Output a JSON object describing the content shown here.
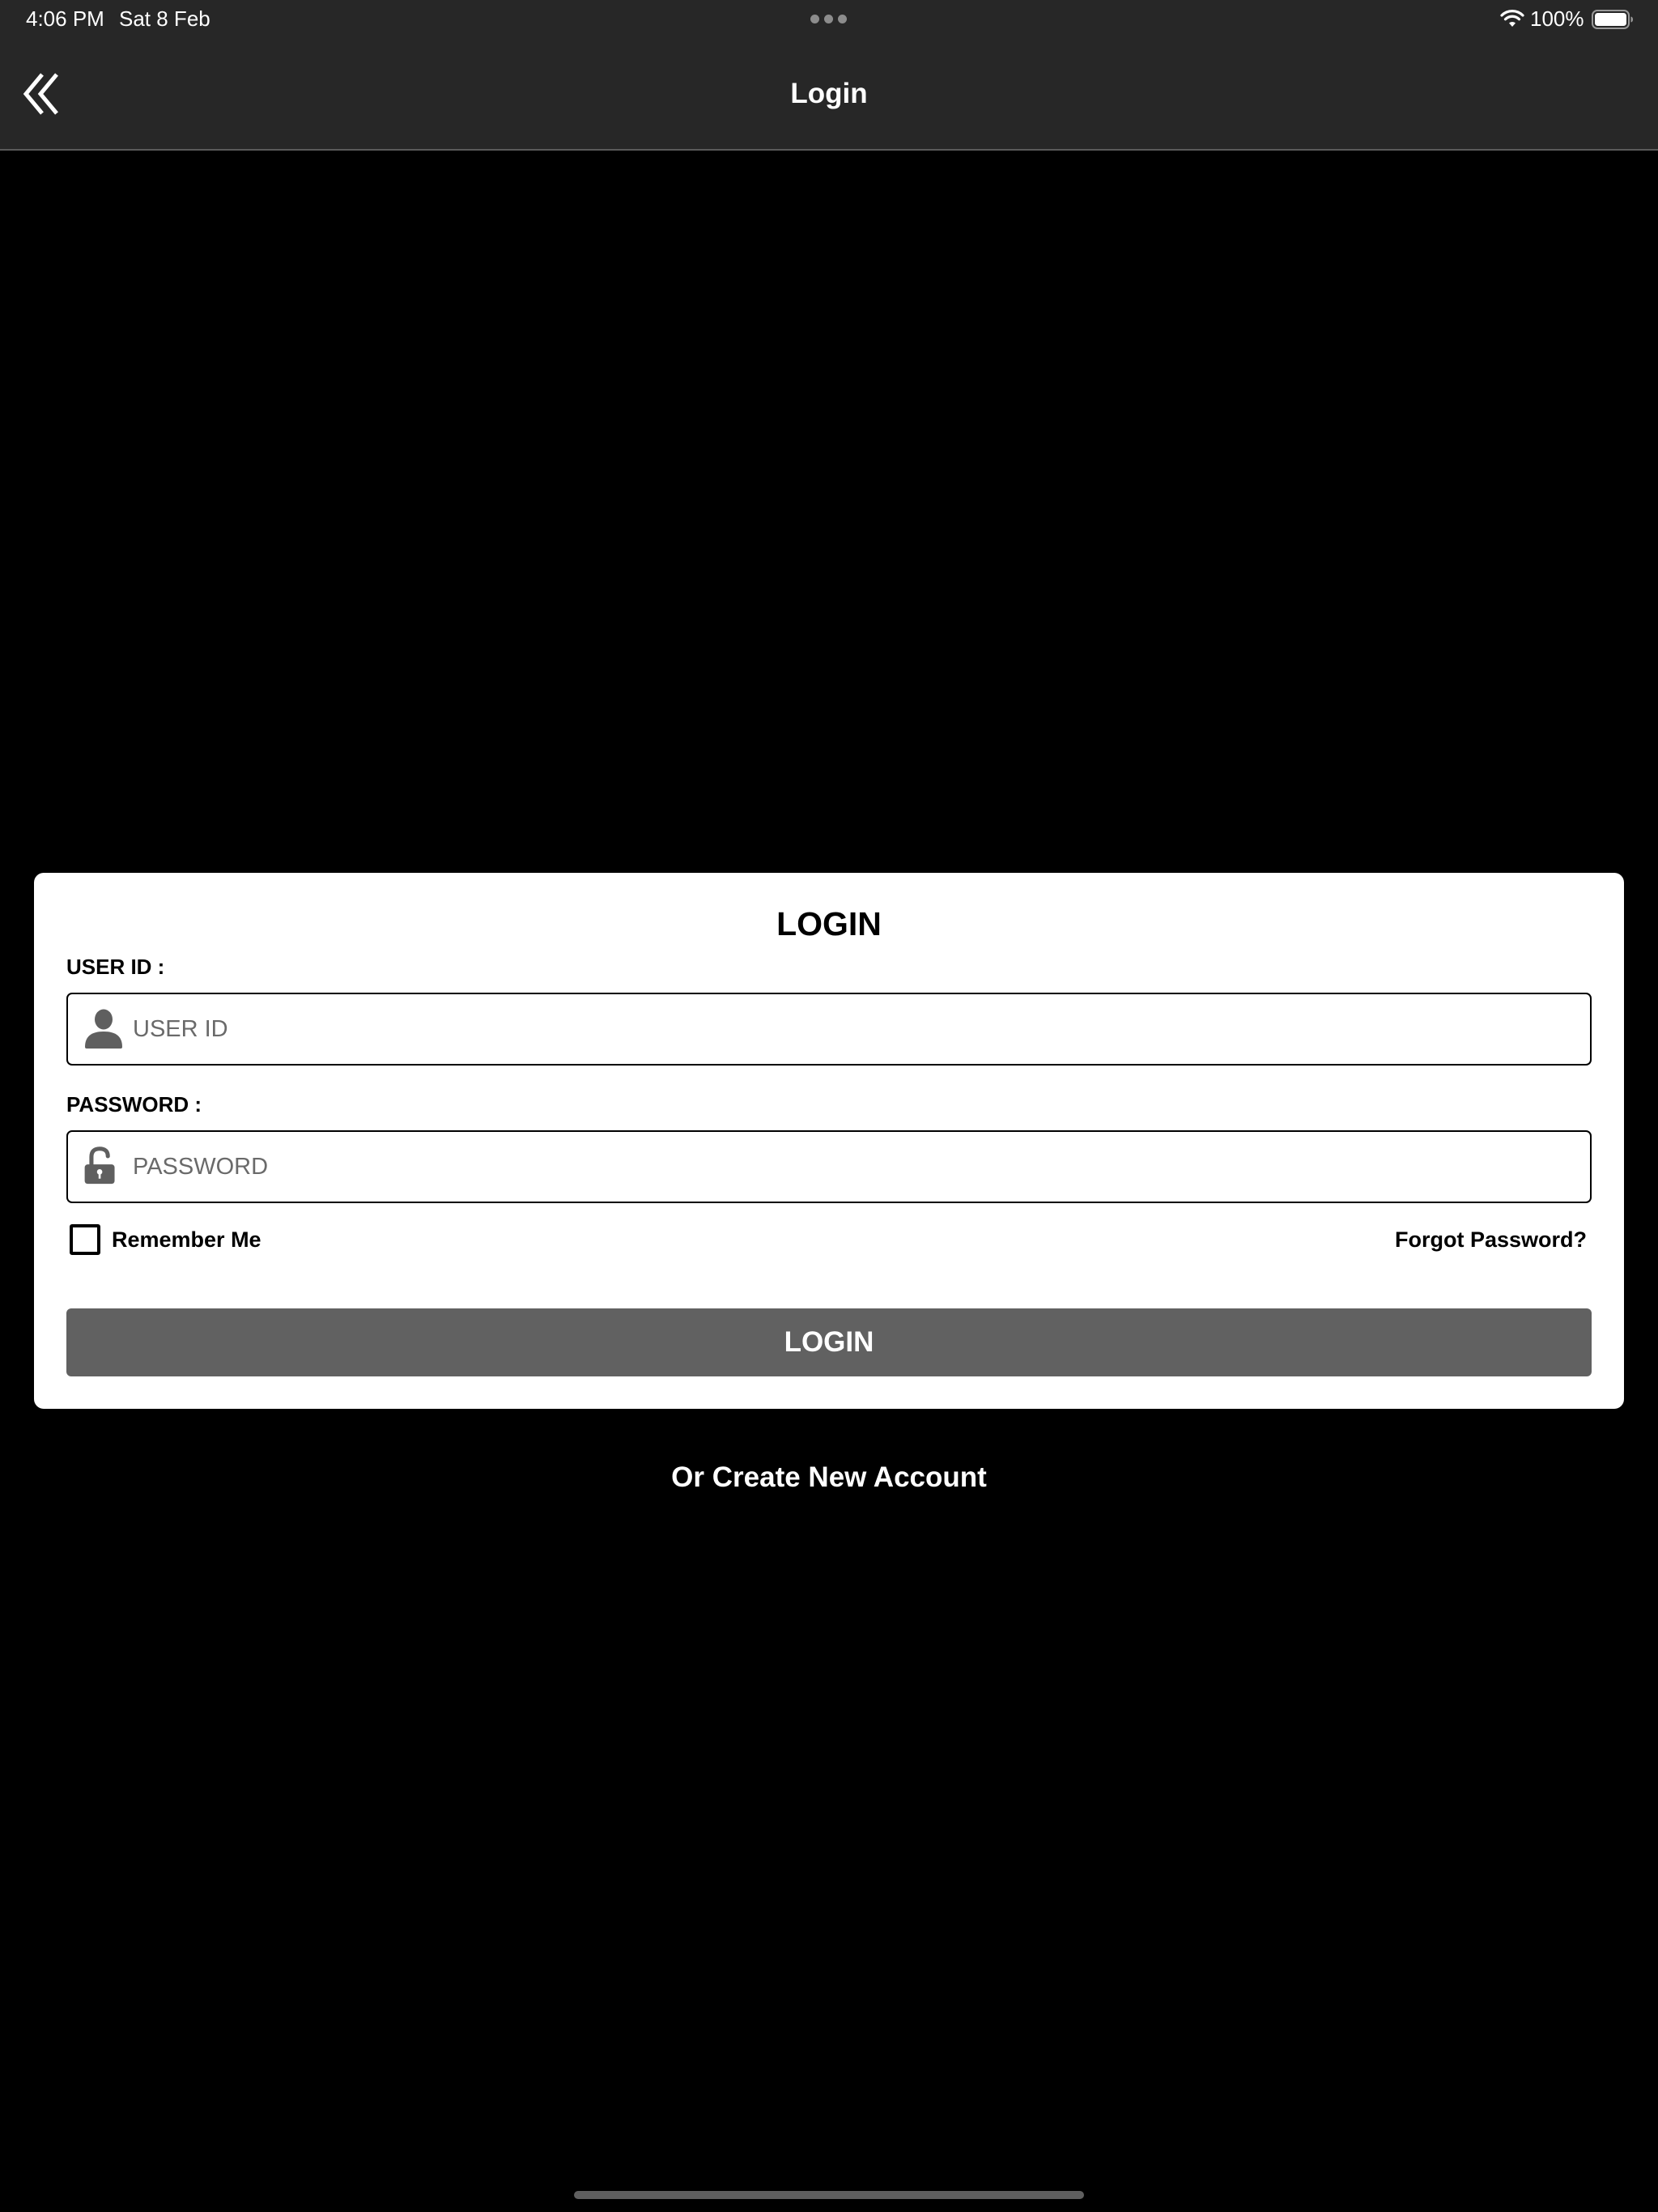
{
  "status_bar": {
    "time": "4:06 PM",
    "date": "Sat 8 Feb",
    "battery_percent": "100%",
    "battery_level": 1.0,
    "icons": [
      "multitasking-dots",
      "wifi-icon",
      "battery-icon"
    ]
  },
  "nav_bar": {
    "title": "Login",
    "back_icon": "double-chevron-left-icon"
  },
  "login_card": {
    "title": "LOGIN",
    "user_id": {
      "label": "USER ID :",
      "placeholder": "USER ID",
      "value": "",
      "icon": "user-icon"
    },
    "password": {
      "label": "PASSWORD :",
      "placeholder": "PASSWORD",
      "value": "",
      "icon": "unlocked-padlock-icon"
    },
    "remember_me": {
      "label": "Remember Me",
      "checked": false
    },
    "forgot_password": "Forgot Password?",
    "login_button": "LOGIN"
  },
  "create_account": "Or Create New Account",
  "colors": {
    "background": "#000000",
    "bar_background": "#272727",
    "card_background": "#ffffff",
    "button_background": "#616161",
    "placeholder_text": "#6a6a6a",
    "icon_gray": "#5f5f5f"
  }
}
